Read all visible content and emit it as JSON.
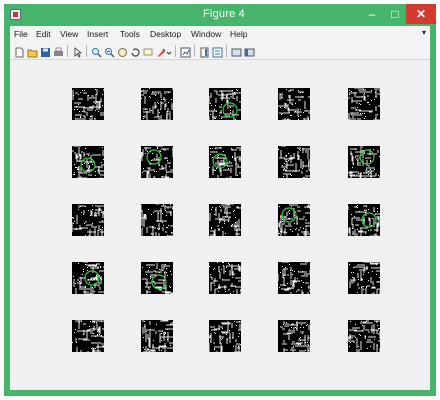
{
  "window": {
    "title": "Figure 4",
    "buttons": {
      "minimize": "–",
      "maximize": "□",
      "close": "✕"
    }
  },
  "menubar": {
    "items": [
      "File",
      "Edit",
      "View",
      "Insert",
      "Tools",
      "Desktop",
      "Window",
      "Help"
    ],
    "overflow_glyph": "▾"
  },
  "toolbar": {
    "icons": [
      "new-figure-icon",
      "open-file-icon",
      "save-figure-icon",
      "print-figure-icon",
      "edit-plot-icon",
      "zoom-in-icon",
      "zoom-out-icon",
      "pan-icon",
      "rotate-3d-icon",
      "data-cursor-icon",
      "brush-icon",
      "brush-dropdown-icon",
      "link-plot-icon",
      "insert-colorbar-icon",
      "insert-legend-icon",
      "hide-plot-tools-icon",
      "show-plot-tools-icon"
    ]
  },
  "figure": {
    "rows": 5,
    "cols": 5,
    "panels": [
      {
        "seed": 11,
        "circle": false
      },
      {
        "seed": 12,
        "circle": false
      },
      {
        "seed": 13,
        "circle": true
      },
      {
        "seed": 14,
        "circle": false
      },
      {
        "seed": 15,
        "circle": false
      },
      {
        "seed": 21,
        "circle": true
      },
      {
        "seed": 22,
        "circle": true
      },
      {
        "seed": 23,
        "circle": true
      },
      {
        "seed": 24,
        "circle": false
      },
      {
        "seed": 25,
        "circle": true
      },
      {
        "seed": 31,
        "circle": false
      },
      {
        "seed": 32,
        "circle": false
      },
      {
        "seed": 33,
        "circle": false
      },
      {
        "seed": 34,
        "circle": true
      },
      {
        "seed": 35,
        "circle": true
      },
      {
        "seed": 41,
        "circle": true
      },
      {
        "seed": 42,
        "circle": true
      },
      {
        "seed": 43,
        "circle": false
      },
      {
        "seed": 44,
        "circle": false
      },
      {
        "seed": 45,
        "circle": false
      },
      {
        "seed": 51,
        "circle": false
      },
      {
        "seed": 52,
        "circle": false
      },
      {
        "seed": 53,
        "circle": false
      },
      {
        "seed": 54,
        "circle": false
      },
      {
        "seed": 55,
        "circle": false
      }
    ]
  },
  "colors": {
    "window_frame": "#46b46a",
    "close_button": "#d33b30",
    "figure_background": "#f0f0f0",
    "axes_background": "#000000",
    "edge_pixels": "#ffffff",
    "circle_overlay": "#2ecc40"
  }
}
